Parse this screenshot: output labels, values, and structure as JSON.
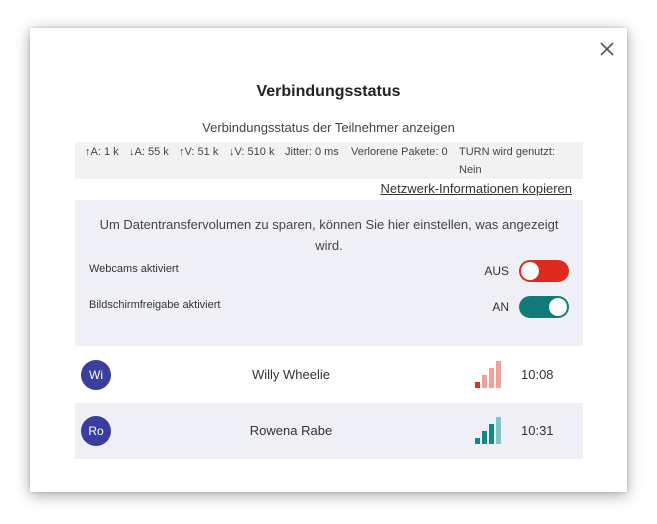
{
  "dialog": {
    "title": "Verbindungsstatus",
    "subtitle": "Verbindungsstatus der Teilnehmer anzeigen",
    "close_icon": "close-icon"
  },
  "stats": [
    {
      "label": "↑A: 1 k"
    },
    {
      "label": "↓A: 55 k"
    },
    {
      "label": "↑V: 51 k"
    },
    {
      "label": "↓V: 510 k"
    },
    {
      "label": "Jitter: 0 ms"
    },
    {
      "label": "Verlorene Pakete: 0"
    },
    {
      "label": "TURN wird genutzt: Nein"
    }
  ],
  "copy_link": "Netzwerk-Informationen kopieren",
  "settings": {
    "description": "Um Datentransfervolumen zu sparen, können Sie hier einstellen, was angezeigt wird.",
    "webcams": {
      "label": "Webcams aktiviert",
      "state": "AUS",
      "on": false
    },
    "screenshare": {
      "label": "Bildschirmfreigabe aktiviert",
      "state": "AN",
      "on": true
    }
  },
  "participants": [
    {
      "initials": "Wi",
      "name": "Willy Wheelie",
      "time": "10:08",
      "signal_level": 1,
      "signal_color": "#d93030",
      "signal_faded": "#f0a09a"
    },
    {
      "initials": "Ro",
      "name": "Rowena Rabe",
      "time": "10:31",
      "signal_level": 3,
      "signal_color": "#0f8a8a",
      "signal_faded": "#7fc4c4"
    }
  ],
  "colors": {
    "toggle_off": "#e02a1e",
    "toggle_on": "#107a78",
    "avatar": "#3a3f9e"
  }
}
